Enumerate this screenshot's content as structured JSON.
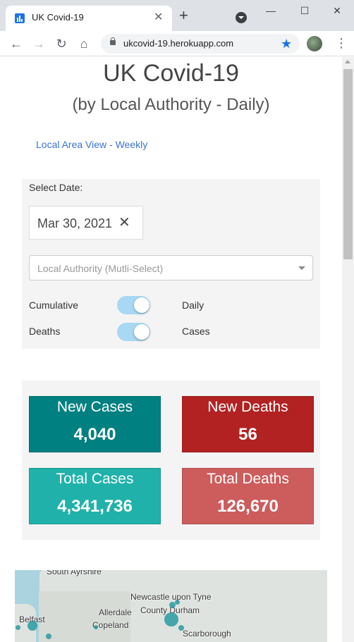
{
  "browser": {
    "tab_title": "UK Covid-19",
    "tab_close": "✕",
    "new_tab": "+",
    "url": "ukcovid-19.herokuapp.com",
    "window_minimize": "—",
    "window_maximize": "☐",
    "window_close": "✕",
    "back": "←",
    "forward": "→",
    "reload": "↻",
    "home": "⌂",
    "star": "★",
    "menu": "⋮"
  },
  "page": {
    "title": "UK Covid-19",
    "subtitle": "(by Local Authority - Daily)",
    "weekly_link": "Local Area View - Weekly"
  },
  "filters": {
    "select_date_label": "Select Date:",
    "date_value": "Mar 30, 2021",
    "date_clear": "✕",
    "local_authority_placeholder": "Local Authority (Mutli-Select)",
    "toggles": [
      {
        "left_label": "Cumulative",
        "right_label": "Daily"
      },
      {
        "left_label": "Deaths",
        "right_label": "Cases"
      }
    ]
  },
  "stats": {
    "new_cases": {
      "label": "New Cases",
      "value": "4,040",
      "color": "#008080"
    },
    "new_deaths": {
      "label": "New Deaths",
      "value": "56",
      "color": "#b22222"
    },
    "total_cases": {
      "label": "Total Cases",
      "value": "4,341,736",
      "color": "#20b2aa"
    },
    "total_deaths": {
      "label": "Total Deaths",
      "value": "126,670",
      "color": "#cd5c5c"
    }
  },
  "map": {
    "labels": [
      "South Ayrshire",
      "Newcastle upon Tyne",
      "Allerdale",
      "County Durham",
      "Belfast",
      "Copeland",
      "Scarborough"
    ]
  },
  "colors": {
    "accent_link": "#3b73d1",
    "toggle_track": "#a8d8f4",
    "map_water": "#aad3df",
    "map_marker": "#1b969c"
  }
}
